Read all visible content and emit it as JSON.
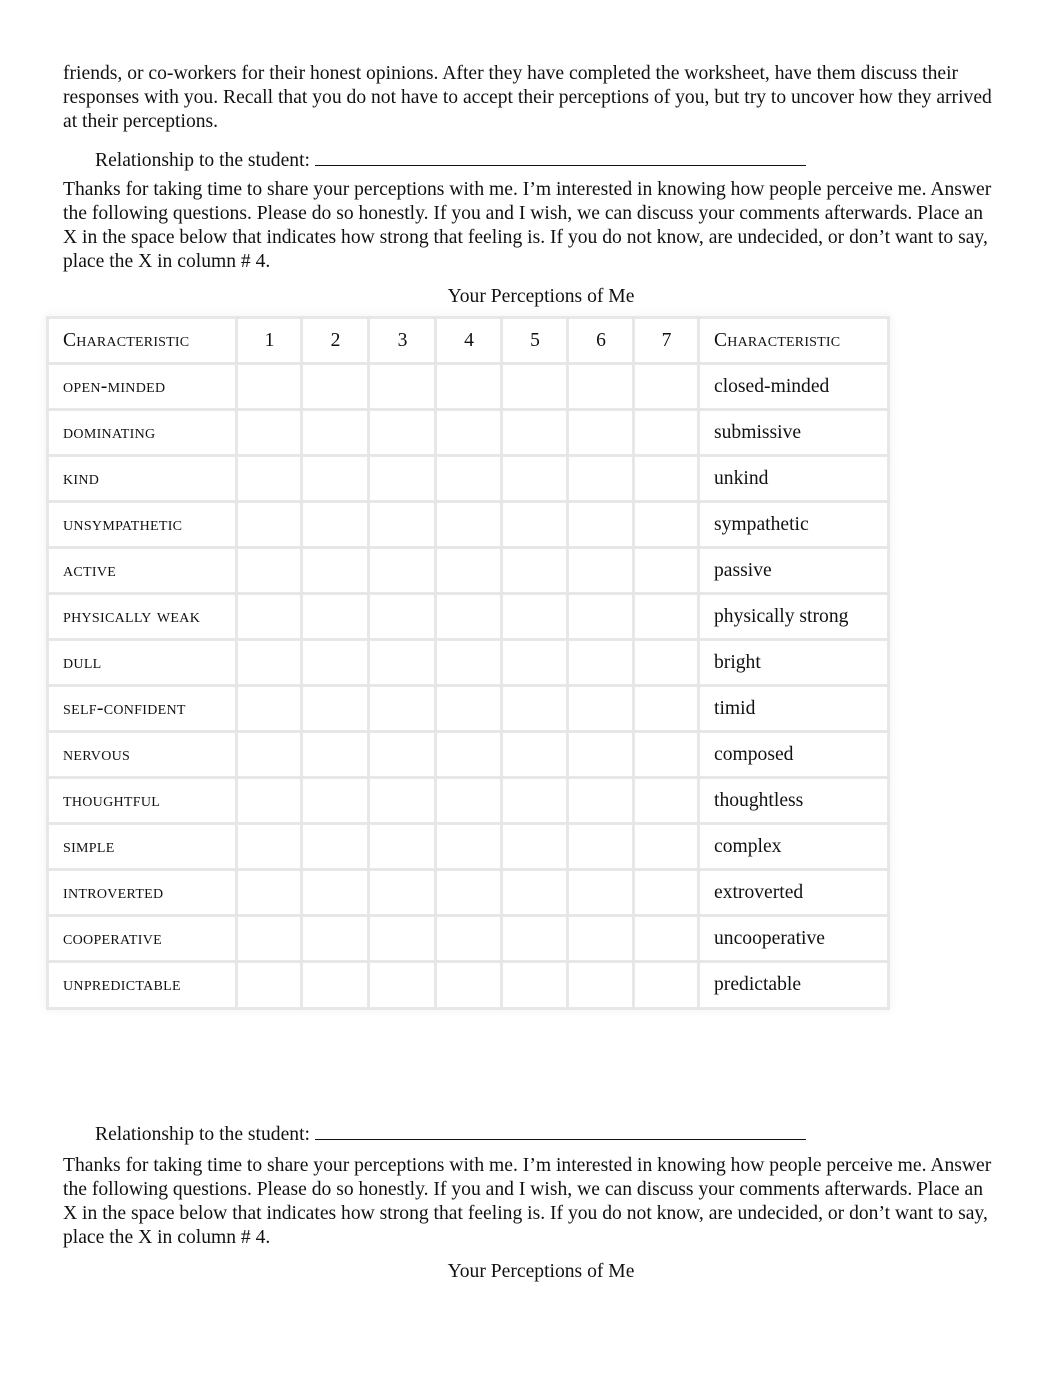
{
  "intro_paragraph": "friends, or co-workers for their honest opinions. After they have completed the worksheet, have them discuss their responses with you. Recall that you do not have to accept their perceptions of you, but try to uncover how they arrived at their perceptions.",
  "form_sections": [
    {
      "relationship_label": "Relationship to the student:",
      "relationship_value": "",
      "instructions": "Thanks for taking time to share your perceptions with me. I’m interested in knowing how people perceive me. Answer the following questions. Please do so honestly. If you and I wish, we can discuss your comments afterwards. Place an X in the space below that indicates how strong that feeling is. If you do not know, are undecided, or don’t want to say, place the X in column # 4.",
      "table_title": "Your Perceptions of Me"
    },
    {
      "relationship_label": "Relationship to the student:",
      "relationship_value": "",
      "instructions": "Thanks for taking time to share your perceptions with me. I’m interested in knowing how people perceive me. Answer the following questions. Please do so honestly. If you and I wish, we can discuss your comments afterwards. Place an X in the space below that indicates how strong that feeling is. If you do not know, are undecided, or don’t want to say, place the X in column # 4.",
      "table_title": "Your Perceptions of Me"
    }
  ],
  "table": {
    "header_left": "Characteristic",
    "scale": [
      "1",
      "2",
      "3",
      "4",
      "5",
      "6",
      "7"
    ],
    "header_right": "Characteristic",
    "rows": [
      {
        "left": "open-minded",
        "right": "closed-minded"
      },
      {
        "left": "dominating",
        "right": "submissive"
      },
      {
        "left": "kind",
        "right": "unkind"
      },
      {
        "left": "unsympathetic",
        "right": "sympathetic"
      },
      {
        "left": "active",
        "right": "passive"
      },
      {
        "left": "physically  weak",
        "right": "physically strong"
      },
      {
        "left": "dull",
        "right": "bright"
      },
      {
        "left": "self-confident",
        "right": "timid"
      },
      {
        "left": "nervous",
        "right": "composed"
      },
      {
        "left": "thoughtful",
        "right": "thoughtless"
      },
      {
        "left": "simple",
        "right": "complex"
      },
      {
        "left": "introverted",
        "right": "extroverted"
      },
      {
        "left": "cooperative",
        "right": "uncooperative"
      },
      {
        "left": "unpredictable",
        "right": "predictable"
      }
    ]
  }
}
